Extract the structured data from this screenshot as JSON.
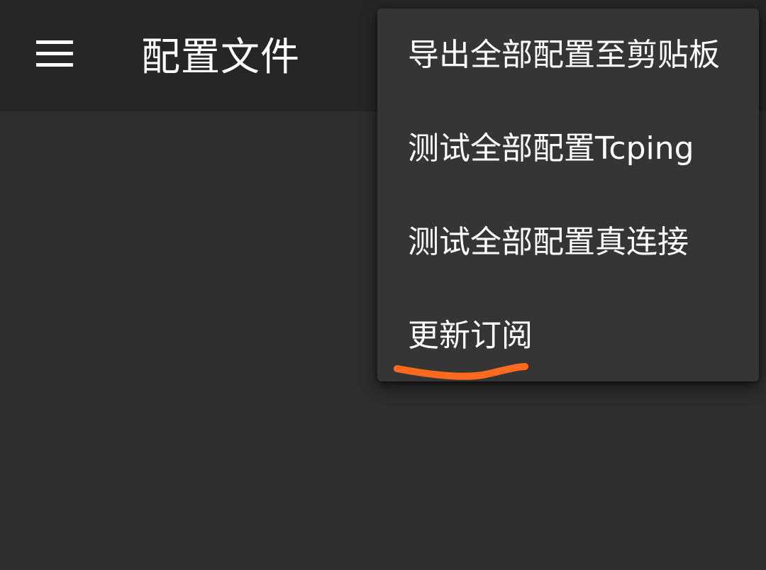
{
  "app_bar": {
    "menu_icon": "hamburger-menu-icon",
    "title": "配置文件"
  },
  "overflow_menu": {
    "items": [
      {
        "label": "导出全部配置至剪贴板"
      },
      {
        "label": "测试全部配置Tcping"
      },
      {
        "label": "测试全部配置真连接"
      },
      {
        "label": "更新订阅"
      }
    ]
  },
  "annotation": {
    "highlighted_item": "更新订阅",
    "stroke_color": "#ff6a1f"
  },
  "colors": {
    "background": "#2e2e2e",
    "app_bar": "#262626",
    "menu_surface": "#353535",
    "text": "#ffffff"
  }
}
